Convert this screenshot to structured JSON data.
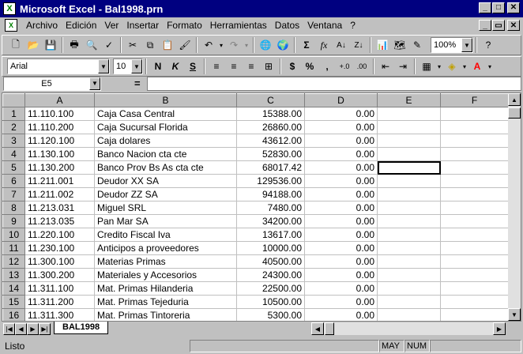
{
  "window": {
    "title": "Microsoft Excel - Bal1998.prn",
    "minimize": "_",
    "maximize": "□",
    "close": "✕",
    "doc_restore": "▭"
  },
  "menu": [
    {
      "label": "Archivo"
    },
    {
      "label": "Edición"
    },
    {
      "label": "Ver"
    },
    {
      "label": "Insertar"
    },
    {
      "label": "Formato"
    },
    {
      "label": "Herramientas"
    },
    {
      "label": "Datos"
    },
    {
      "label": "Ventana"
    },
    {
      "label": "?"
    }
  ],
  "toolbar": {
    "zoom": "100%",
    "font_name": "Arial",
    "font_size": "10",
    "bold_label": "N",
    "italic_label": "K",
    "underline_label": "S",
    "currency_label": "$",
    "percent_label": "%",
    "thousands_label": ",",
    "sum_label": "Σ",
    "fx_label": "fx"
  },
  "formula_bar": {
    "name_box": "E5",
    "equals": "=",
    "content": ""
  },
  "grid": {
    "columns": [
      "A",
      "B",
      "C",
      "D",
      "E",
      "F"
    ],
    "active_col": "E",
    "active_row": 5,
    "rows": [
      {
        "n": "1",
        "a": "11.110.100",
        "b": "Caja Casa Central",
        "c": "15388.00",
        "d": "0.00"
      },
      {
        "n": "2",
        "a": "11.110.200",
        "b": "Caja Sucursal Florida",
        "c": "26860.00",
        "d": "0.00"
      },
      {
        "n": "3",
        "a": "11.120.100",
        "b": "Caja dolares",
        "c": "43612.00",
        "d": "0.00"
      },
      {
        "n": "4",
        "a": "11.130.100",
        "b": "Banco Nacion cta cte",
        "c": "52830.00",
        "d": "0.00"
      },
      {
        "n": "5",
        "a": "11.130.200",
        "b": "Banco Prov Bs As cta cte",
        "c": "68017.42",
        "d": "0.00"
      },
      {
        "n": "6",
        "a": "11.211.001",
        "b": "Deudor XX SA",
        "c": "129536.00",
        "d": "0.00"
      },
      {
        "n": "7",
        "a": "11.211.002",
        "b": "Deudor ZZ SA",
        "c": "94188.00",
        "d": "0.00"
      },
      {
        "n": "8",
        "a": "11.213.031",
        "b": "Miguel SRL",
        "c": "7480.00",
        "d": "0.00"
      },
      {
        "n": "9",
        "a": "11.213.035",
        "b": "Pan Mar SA",
        "c": "34200.00",
        "d": "0.00"
      },
      {
        "n": "10",
        "a": "11.220.100",
        "b": "Credito Fiscal Iva",
        "c": "13617.00",
        "d": "0.00"
      },
      {
        "n": "11",
        "a": "11.230.100",
        "b": "Anticipos a proveedores",
        "c": "10000.00",
        "d": "0.00"
      },
      {
        "n": "12",
        "a": "11.300.100",
        "b": "Materias Primas",
        "c": "40500.00",
        "d": "0.00"
      },
      {
        "n": "13",
        "a": "11.300.200",
        "b": "Materiales y Accesorios",
        "c": "24300.00",
        "d": "0.00"
      },
      {
        "n": "14",
        "a": "11.311.100",
        "b": "Mat. Primas Hilanderia",
        "c": "22500.00",
        "d": "0.00"
      },
      {
        "n": "15",
        "a": "11.311.200",
        "b": "Mat. Primas Tejeduria",
        "c": "10500.00",
        "d": "0.00"
      },
      {
        "n": "16",
        "a": "11.311.300",
        "b": "Mat. Primas Tintoreria",
        "c": "5300.00",
        "d": "0.00"
      }
    ]
  },
  "sheet_tab": "BAL1998",
  "status": {
    "text": "Listo",
    "may": "MAY",
    "num": "NUM"
  }
}
